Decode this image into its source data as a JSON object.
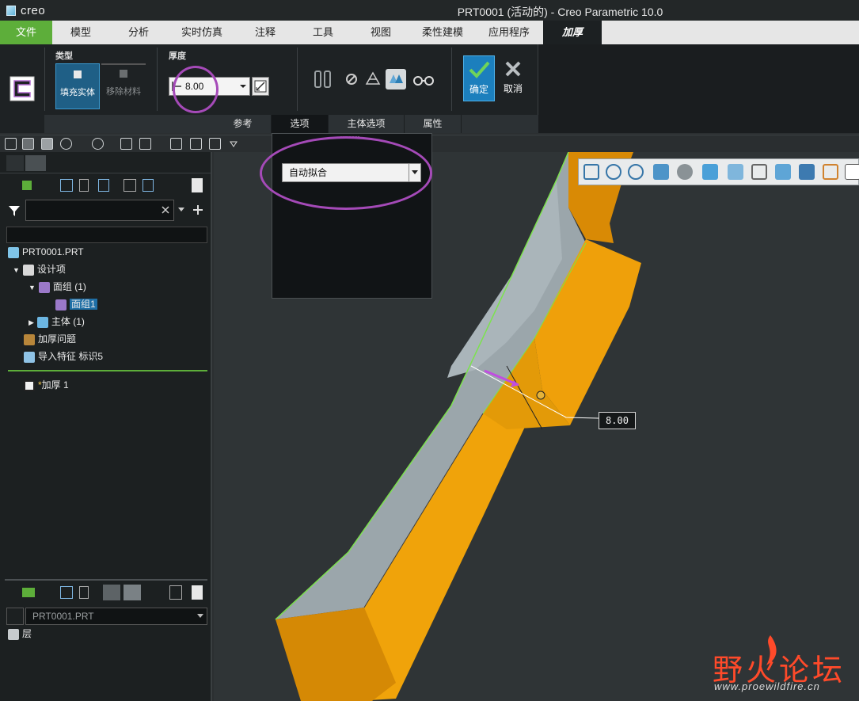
{
  "app": {
    "logo_text": "creo",
    "window_title": "PRT0001 (活动的) - Creo Parametric 10.0"
  },
  "menu": [
    "文件",
    "模型",
    "分析",
    "实时仿真",
    "注释",
    "工具",
    "视图",
    "柔性建模",
    "应用程序",
    "加厚"
  ],
  "ribbon": {
    "type_label": "类型",
    "fill_solid": "填充实体",
    "remove_material": "移除材料",
    "thickness_label": "厚度",
    "thickness_value": "8.00",
    "ok": "确定",
    "cancel": "取消"
  },
  "subtabs": [
    "参考",
    "选项",
    "主体选项",
    "属性"
  ],
  "options_panel": {
    "fit_select": "自动拟合"
  },
  "tree": {
    "items": [
      {
        "label": "PRT0001.PRT"
      },
      {
        "label": "设计项"
      },
      {
        "label": "面组 (1)"
      },
      {
        "label": "面组1"
      },
      {
        "label": "主体 (1)"
      },
      {
        "label": "加厚问题"
      },
      {
        "label": "导入特征 标识5"
      },
      {
        "label": "加厚 1"
      }
    ]
  },
  "layers": {
    "model": "PRT0001.PRT",
    "layer_label": "层"
  },
  "viewport": {
    "dimension": "8.00"
  },
  "watermark": {
    "text": "野火论坛",
    "url": "www.proewildfire.cn"
  },
  "colors": {
    "accent_green": "#5dae3a",
    "ok_blue": "#1c7fbd",
    "highlight_purple": "#a54ab8",
    "solid_orange": "#f0a30a"
  }
}
